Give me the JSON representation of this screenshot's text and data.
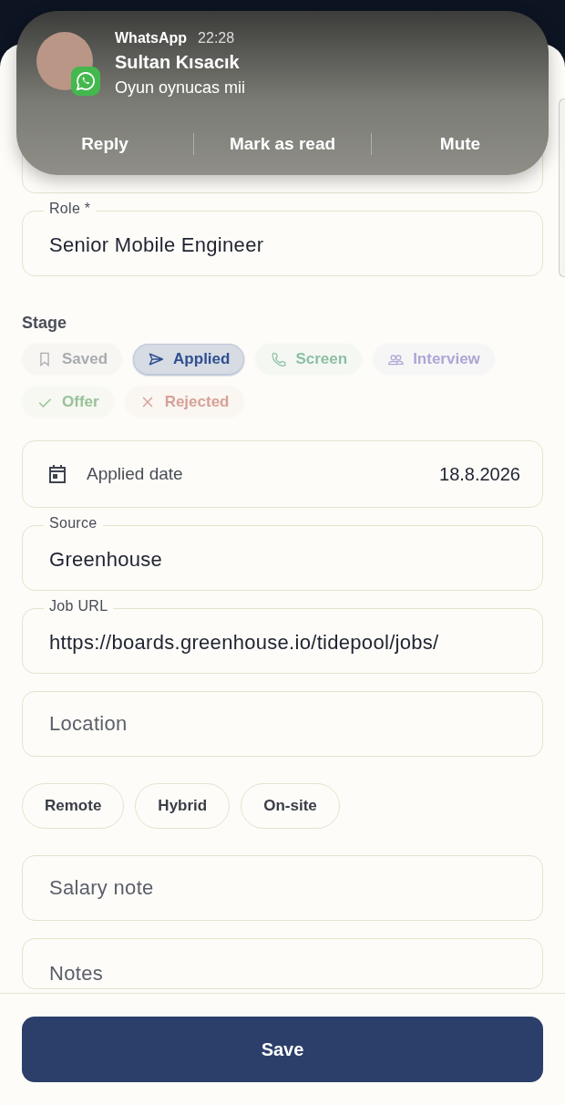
{
  "notification": {
    "app": "WhatsApp",
    "time": "22:28",
    "sender": "Sultan Kısacık",
    "message": "Oyun oynucas mii",
    "actions": [
      "Reply",
      "Mark as read",
      "Mute"
    ]
  },
  "role": {
    "label": "Role *",
    "value": "Senior Mobile Engineer"
  },
  "stage": {
    "label": "Stage",
    "options": [
      {
        "label": "Saved",
        "color": "#a9abb0",
        "selected": false
      },
      {
        "label": "Applied",
        "color": "#2f4f8f",
        "selected": true
      },
      {
        "label": "Screen",
        "color": "#8cbfa5",
        "selected": false
      },
      {
        "label": "Interview",
        "color": "#ada6d6",
        "selected": false
      },
      {
        "label": "Offer",
        "color": "#99c29a",
        "selected": false
      },
      {
        "label": "Rejected",
        "color": "#d6a198",
        "selected": false
      }
    ]
  },
  "applied_date": {
    "label": "Applied date",
    "value": "18.8.2026"
  },
  "source": {
    "label": "Source",
    "value": "Greenhouse"
  },
  "job_url": {
    "label": "Job URL",
    "value": "https://boards.greenhouse.io/tidepool/jobs/"
  },
  "location": {
    "placeholder": "Location"
  },
  "work_modes": [
    {
      "label": "Remote",
      "selected": false
    },
    {
      "label": "Hybrid",
      "selected": false
    },
    {
      "label": "On-site",
      "selected": false
    }
  ],
  "salary_note": {
    "placeholder": "Salary note"
  },
  "notes": {
    "placeholder": "Notes"
  },
  "save_button": "Save"
}
